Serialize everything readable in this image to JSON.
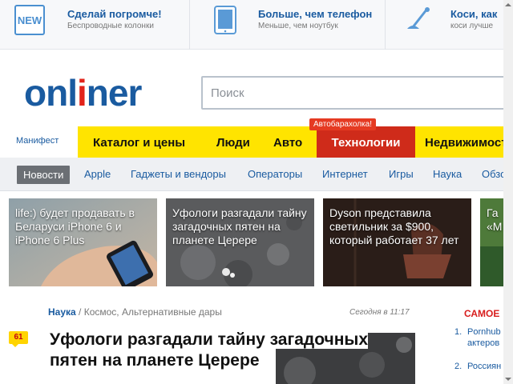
{
  "promo": [
    {
      "title": "Сделай погромче!",
      "subtitle": "Беспроводные колонки",
      "icon": "new-badge-icon"
    },
    {
      "title": "Больше, чем телефон",
      "subtitle": "Меньше, чем ноутбук",
      "icon": "tablet-icon"
    },
    {
      "title": "Коси, как",
      "subtitle": "коси лучше",
      "icon": "trimmer-icon"
    }
  ],
  "promo_badge_text": "NEW",
  "logo_text": "onliner",
  "search": {
    "placeholder": "Поиск"
  },
  "manifest": "Манифест",
  "main_nav": [
    {
      "label": "Каталог и цены"
    },
    {
      "label": "Люди"
    },
    {
      "label": "Авто"
    },
    {
      "label": "Технологии"
    },
    {
      "label": "Недвижимость"
    }
  ],
  "nav_badge": "Автобарахолка!",
  "sub_nav": [
    "Новости",
    "Apple",
    "Гаджеты и вендоры",
    "Операторы",
    "Интернет",
    "Игры",
    "Наука",
    "Обзоры"
  ],
  "stories": [
    {
      "text": "life:) будет продавать в Беларуси iPhone 6 и iPhone 6 Plus"
    },
    {
      "text": "Уфологи разгадали тайну загадочных пятен на планете Церере"
    },
    {
      "text": "Dyson представила светильник за $900, который работает 37 лет"
    },
    {
      "text": "Га «М"
    }
  ],
  "article": {
    "section": "Наука",
    "separator": " / ",
    "tags": "Космос, Альтернативные дары",
    "date": "Сегодня в 11:17",
    "comments": "61",
    "title": "Уфологи разгадали тайну загадочных пятен на планете Церере"
  },
  "popular": {
    "heading": "САМОЕ",
    "items": [
      {
        "num": "1.",
        "lines": [
          "Pornhub",
          "актеров"
        ]
      },
      {
        "num": "2.",
        "lines": [
          "Россиян"
        ]
      }
    ]
  },
  "colors": {
    "brand_blue": "#1a5ba0",
    "logo_red": "#e2231a",
    "nav_yellow": "#ffe400",
    "nav_active": "#cf2b1a",
    "popular_red": "#d81d1d"
  }
}
